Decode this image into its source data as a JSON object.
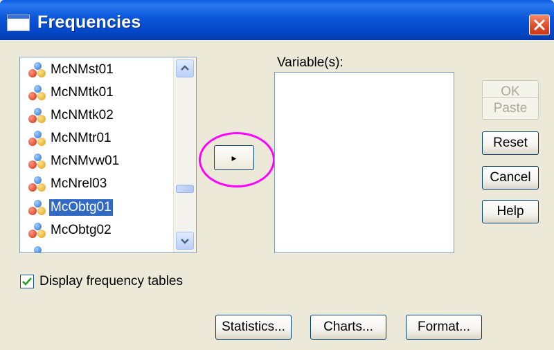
{
  "window": {
    "title": "Frequencies",
    "title_icon": "window-icon",
    "close_icon": "close-icon"
  },
  "source_list": {
    "items": [
      {
        "label": "McNMst01",
        "icon": "variable-icon",
        "selected": false
      },
      {
        "label": "McNMtk01",
        "icon": "variable-icon",
        "selected": false
      },
      {
        "label": "McNMtk02",
        "icon": "variable-icon",
        "selected": false
      },
      {
        "label": "McNMtr01",
        "icon": "variable-icon",
        "selected": false
      },
      {
        "label": "McNMvw01",
        "icon": "variable-icon",
        "selected": false
      },
      {
        "label": "McNrel03",
        "icon": "variable-icon",
        "selected": false
      },
      {
        "label": "McObtg01",
        "icon": "variable-icon",
        "selected": true
      },
      {
        "label": "McObtg02",
        "icon": "variable-icon",
        "selected": false
      }
    ],
    "scroll_up_icon": "chevron-up-icon",
    "scroll_down_icon": "chevron-down-icon"
  },
  "move_button": {
    "icon": "arrow-right-icon",
    "label": "▸"
  },
  "variables": {
    "label": "Variable(s):",
    "items": []
  },
  "actions": {
    "ok": "OK",
    "paste": "Paste",
    "reset": "Reset",
    "cancel": "Cancel",
    "help": "Help"
  },
  "display_tables": {
    "label": "Display frequency tables",
    "checked": true
  },
  "bottom_buttons": {
    "statistics": "Statistics...",
    "charts": "Charts...",
    "format": "Format..."
  },
  "colors": {
    "title_bar": "#0a56d8",
    "selection": "#316ac5",
    "highlight_ring": "#ff00ff",
    "close_button": "#e1532f"
  }
}
